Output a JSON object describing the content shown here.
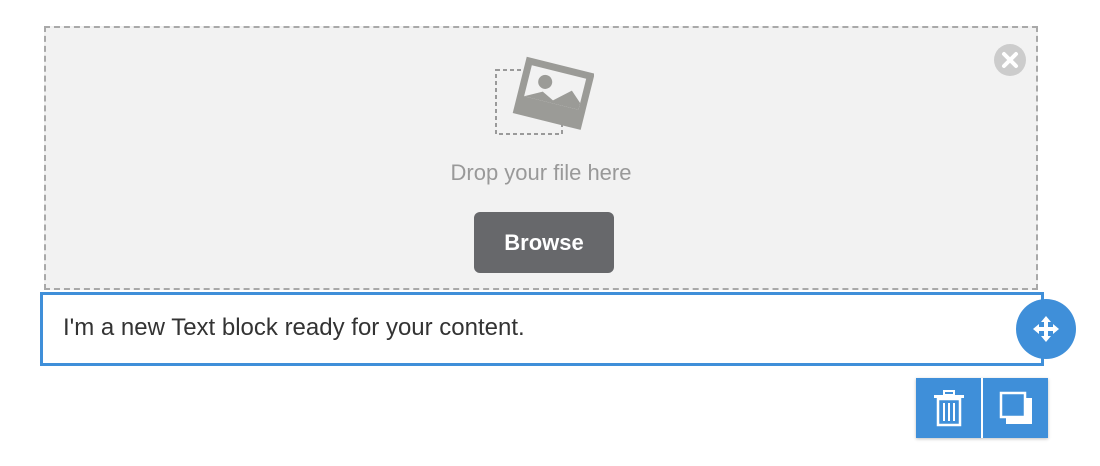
{
  "image_block": {
    "drop_text": "Drop your file here",
    "browse_label": "Browse",
    "placeholder_icon": "image-placeholder-icon",
    "close_icon": "close-circle-icon"
  },
  "text_block": {
    "content": "I'm a new Text block ready for your content."
  },
  "controls": {
    "move_icon": "move-arrows-icon",
    "delete_icon": "trash-icon",
    "duplicate_icon": "duplicate-icon"
  },
  "colors": {
    "accent": "#3f8fd9",
    "button_dark": "#67686b",
    "dropzone_bg": "#f2f2f2",
    "dropzone_border": "#a9a9a9",
    "muted_text": "#999999",
    "body_text": "#333333"
  }
}
